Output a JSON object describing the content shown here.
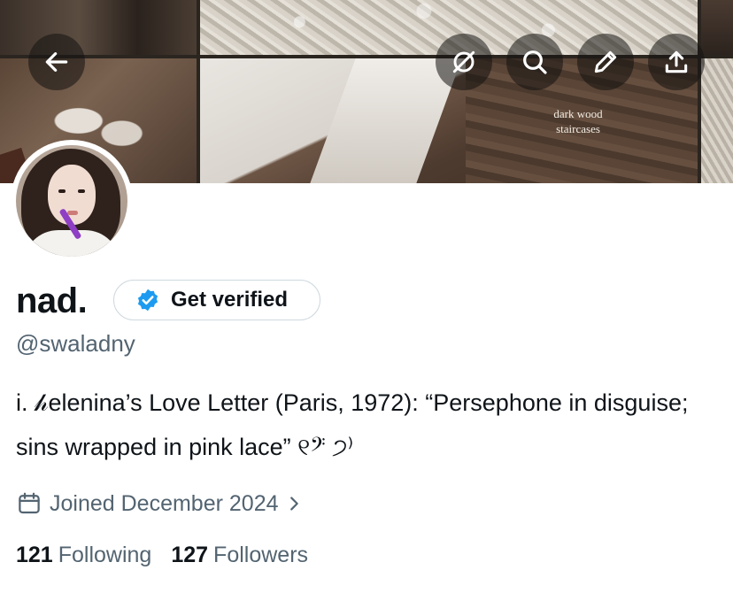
{
  "banner": {
    "caption_line1": "dark wood",
    "caption_line2": "staircases"
  },
  "toolbar": {
    "back_icon": "back-arrow-icon",
    "grok_icon": "slash-circle-icon",
    "search_icon": "search-icon",
    "edit_icon": "pencil-icon",
    "share_icon": "share-icon"
  },
  "profile": {
    "display_name": "nad.",
    "verify_label": "Get verified",
    "handle": "@swaladny",
    "bio": "i. 𝒽elenina’s Love Letter (Paris, 1972): “Persephone in disguise; sins wrapped in pink lace” ୧𝄢 ੭⁾",
    "joined": "Joined December 2024",
    "following_count": "121",
    "following_label": "Following",
    "followers_count": "127",
    "followers_label": "Followers"
  },
  "colors": {
    "text_primary": "#0f1419",
    "text_secondary": "#536471",
    "verified_blue": "#1d9bf0",
    "pill_border": "#cfd9de"
  }
}
